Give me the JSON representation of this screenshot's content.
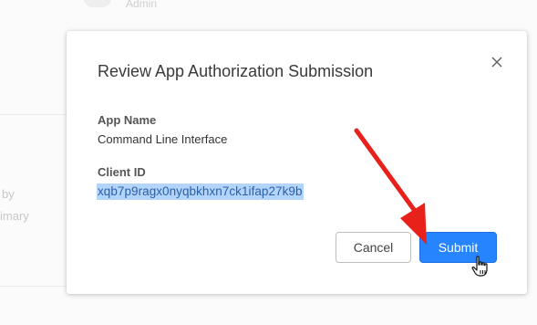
{
  "background": {
    "admin_label": "Admin",
    "side_text_1": "by",
    "side_text_2": "imary"
  },
  "modal": {
    "title": "Review App Authorization Submission",
    "close_icon": "close-icon",
    "fields": {
      "app_name_label": "App Name",
      "app_name_value": "Command Line Interface",
      "client_id_label": "Client ID",
      "client_id_value": "xqb7p9ragx0nyqbkhxn7ck1ifap27k9b"
    },
    "buttons": {
      "cancel_label": "Cancel",
      "submit_label": "Submit"
    }
  },
  "overlay": {
    "annotation_arrow": "red-arrow",
    "cursor_icon": "hand-pointer-icon"
  },
  "colors": {
    "primary": "#2684ff",
    "selection": "#b4d5fb",
    "annotation": "#e8221b"
  }
}
